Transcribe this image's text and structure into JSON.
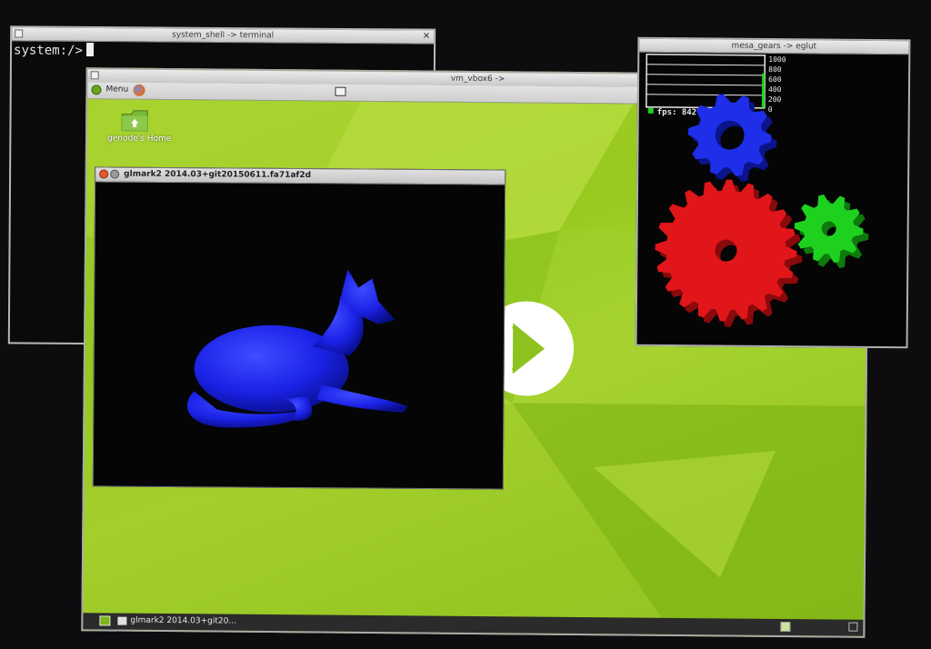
{
  "terminal": {
    "title": "system_shell -> terminal",
    "prompt": "system:/>"
  },
  "vbox": {
    "title": "vm_vbox6 ->",
    "menu_label": "Menu",
    "desktop_icon_label": "genode's Home",
    "taskbar_item": "glmark2 2014.03+git20..."
  },
  "glmark": {
    "title": "glmark2 2014.03+git20150611.fa71af2d"
  },
  "gears": {
    "title": "mesa_gears -> eglut",
    "fps_label": "fps: 842.0",
    "scale": [
      "1000",
      "800",
      "600",
      "400",
      "200",
      "0"
    ],
    "fps_value": 842.0
  },
  "colors": {
    "gear_red": "#e0161a",
    "gear_blue": "#1f2ee8",
    "gear_green": "#1fd11f",
    "desktop_green": "#97c91f",
    "fox_blue": "#1a22e6"
  }
}
